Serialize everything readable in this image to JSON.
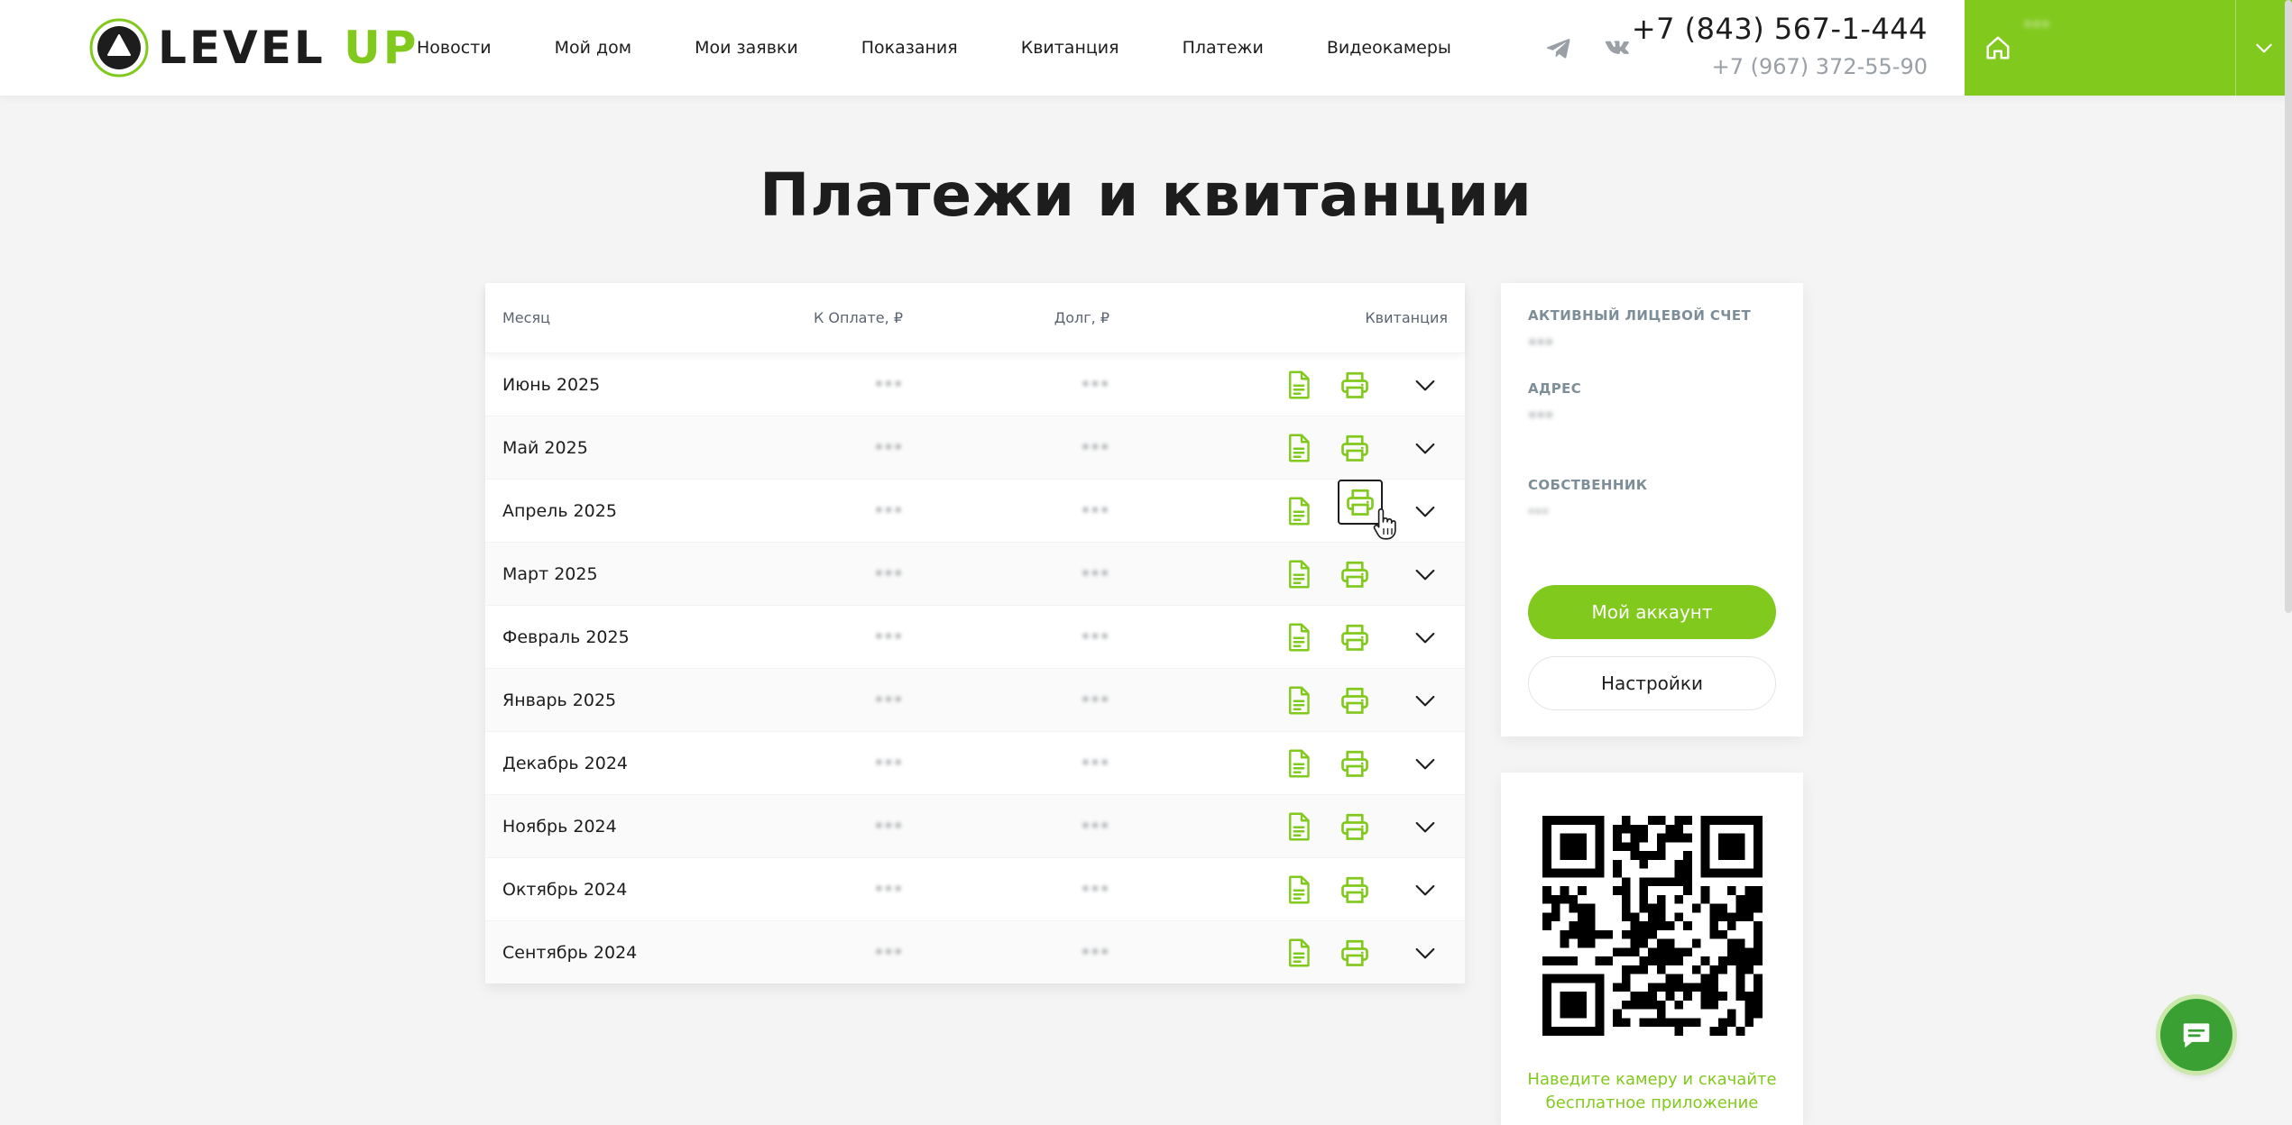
{
  "header": {
    "logo": {
      "text_main": "LEVEL ",
      "text_accent": "UP",
      "icon": "level-up-logo"
    },
    "nav": [
      {
        "label": "Новости"
      },
      {
        "label": "Мой дом"
      },
      {
        "label": "Мои заявки"
      },
      {
        "label": "Показания"
      },
      {
        "label": "Квитанция"
      },
      {
        "label": "Платежи"
      },
      {
        "label": "Видеокамеры"
      }
    ],
    "social": [
      {
        "icon": "telegram-icon"
      },
      {
        "icon": "vk-icon"
      }
    ],
    "phone_primary": "+7 (843) 567-1-444",
    "phone_secondary": "+7 (967) 372-55-90",
    "account": {
      "text": "•••",
      "icon": "home-icon",
      "toggle_icon": "chevron-down-icon"
    }
  },
  "page": {
    "title": "Платежи и квитанции"
  },
  "table": {
    "columns": {
      "month": "Месяц",
      "pay": "К Оплате, ₽",
      "debt": "Долг, ₽",
      "receipt": "Квитанция"
    },
    "rows": [
      {
        "month": "Июнь 2025",
        "pay": "•••",
        "debt": "•••"
      },
      {
        "month": "Май 2025",
        "pay": "•••",
        "debt": "•••"
      },
      {
        "month": "Апрель 2025",
        "pay": "•••",
        "debt": "•••"
      },
      {
        "month": "Март 2025",
        "pay": "•••",
        "debt": "•••"
      },
      {
        "month": "Февраль 2025",
        "pay": "•••",
        "debt": "•••"
      },
      {
        "month": "Январь 2025",
        "pay": "•••",
        "debt": "•••"
      },
      {
        "month": "Декабрь 2024",
        "pay": "•••",
        "debt": "•••"
      },
      {
        "month": "Ноябрь 2024",
        "pay": "•••",
        "debt": "•••"
      },
      {
        "month": "Октябрь 2024",
        "pay": "•••",
        "debt": "•••"
      },
      {
        "month": "Сентябрь 2024",
        "pay": "•••",
        "debt": "•••"
      }
    ],
    "focused_print_row": 2
  },
  "sidebar": {
    "active_account_label": "Активный лицевой счет",
    "active_account_value": "•••",
    "address_label": "Адрес",
    "address_value": "•••",
    "owner_label": "Собственник",
    "owner_value": "•••",
    "my_account_button": "Мой аккаунт",
    "settings_button": "Настройки"
  },
  "qr": {
    "caption": "Наведите камеру и скачайте бесплатное приложение"
  },
  "colors": {
    "accent": "#82c91e",
    "text": "#1d1d1d",
    "muted": "#7d8e99",
    "chat": "#3ba033"
  }
}
